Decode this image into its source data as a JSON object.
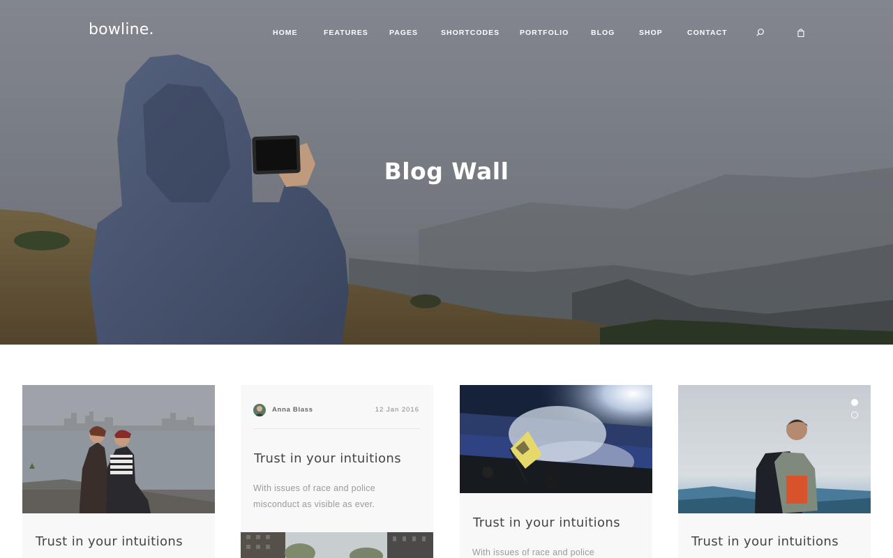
{
  "header": {
    "logo": "bowline.",
    "nav": [
      "HOME",
      "FEATURES",
      "PAGES",
      "SHORTCODES",
      "PORTFOLIO",
      "BLOG",
      "SHOP",
      "CONTACT"
    ],
    "search_icon": "search-icon",
    "cart_icon": "shopping-bag-icon"
  },
  "hero": {
    "title": "Blog Wall"
  },
  "posts": [
    {
      "title": "Trust in your intuitions"
    },
    {
      "author": "Anna Blass",
      "date": "12 Jan 2016",
      "title": "Trust in your intuitions",
      "excerpt_line1": "With issues of race and police",
      "excerpt_line2": "misconduct as visible as ever."
    },
    {
      "title": "Trust in your intuitions",
      "excerpt_line1": "With issues of race and police"
    },
    {
      "title": "Trust in your intuitions",
      "slider_dots": 2,
      "active_dot": 1
    }
  ]
}
